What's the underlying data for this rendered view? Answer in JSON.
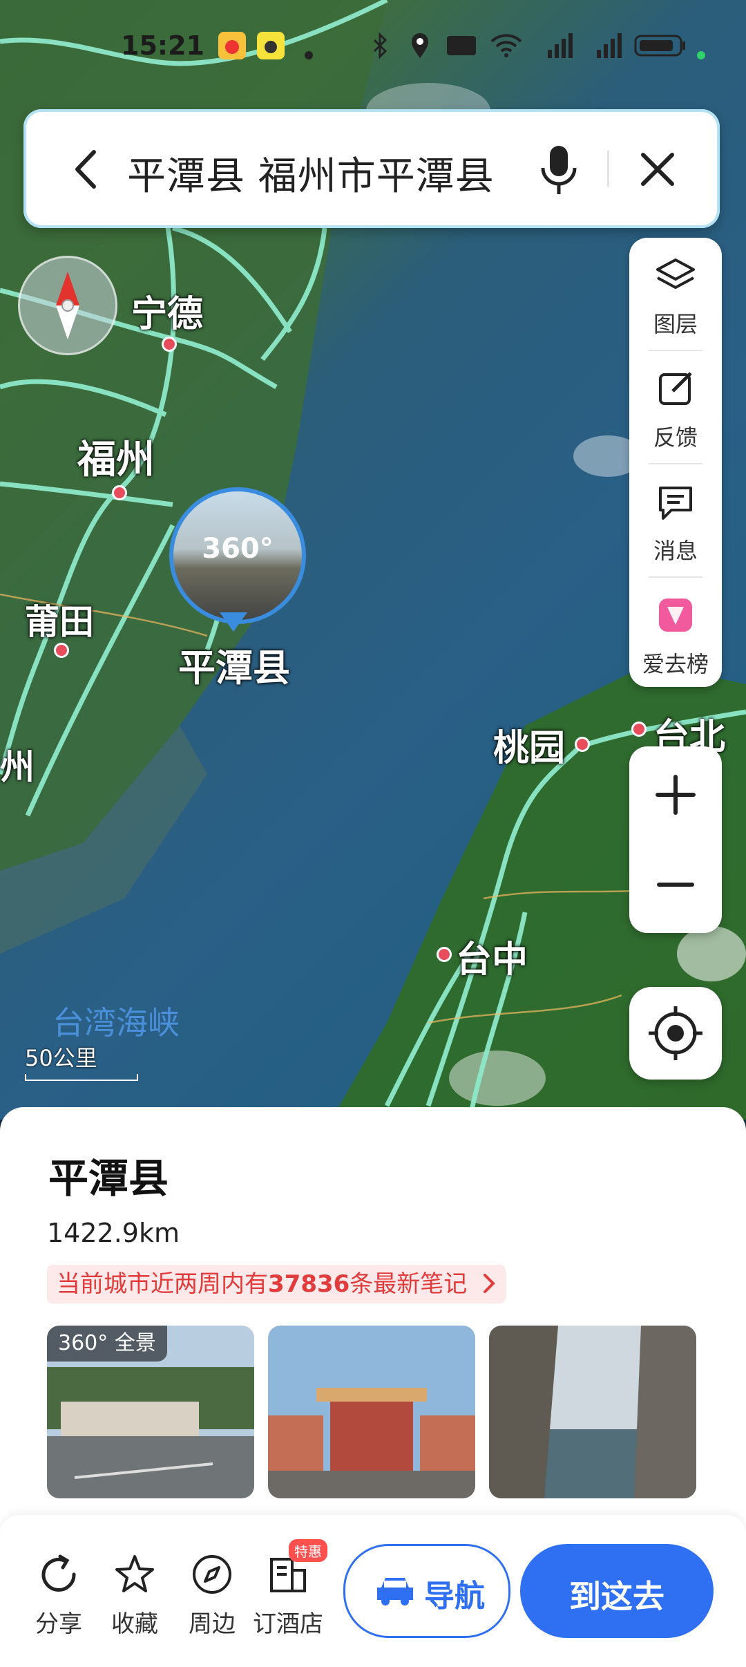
{
  "status_bar": {
    "time": "15:21"
  },
  "search": {
    "query": "平潭县 福州市平潭县"
  },
  "map": {
    "cities": [
      "宁德",
      "福州",
      "莆田",
      "平潭县",
      "桃园",
      "台北",
      "台中",
      "州"
    ],
    "sea_label": "台湾海峡",
    "scale_label": "50公里",
    "pano_label": "360°"
  },
  "tools": [
    {
      "label": "图层",
      "icon": "layers-icon"
    },
    {
      "label": "反馈",
      "icon": "feedback-icon"
    },
    {
      "label": "消息",
      "icon": "message-icon"
    },
    {
      "label": "爱去榜",
      "icon": "ranking-icon"
    }
  ],
  "poi": {
    "title": "平潭县",
    "distance": "1422.9km",
    "notes_prefix": "当前城市近两周内有",
    "notes_count": "37836",
    "notes_suffix": "条最新笔记",
    "photo_tag": "全景"
  },
  "actions": {
    "share": "分享",
    "favorite": "收藏",
    "nearby": "周边",
    "hotel": "订酒店",
    "hotel_badge": "特惠",
    "navigate": "导航",
    "go_here": "到这去"
  },
  "colors": {
    "accent": "#2f6ff2",
    "road": "#8de8c8",
    "pin": "#e84d5b"
  }
}
